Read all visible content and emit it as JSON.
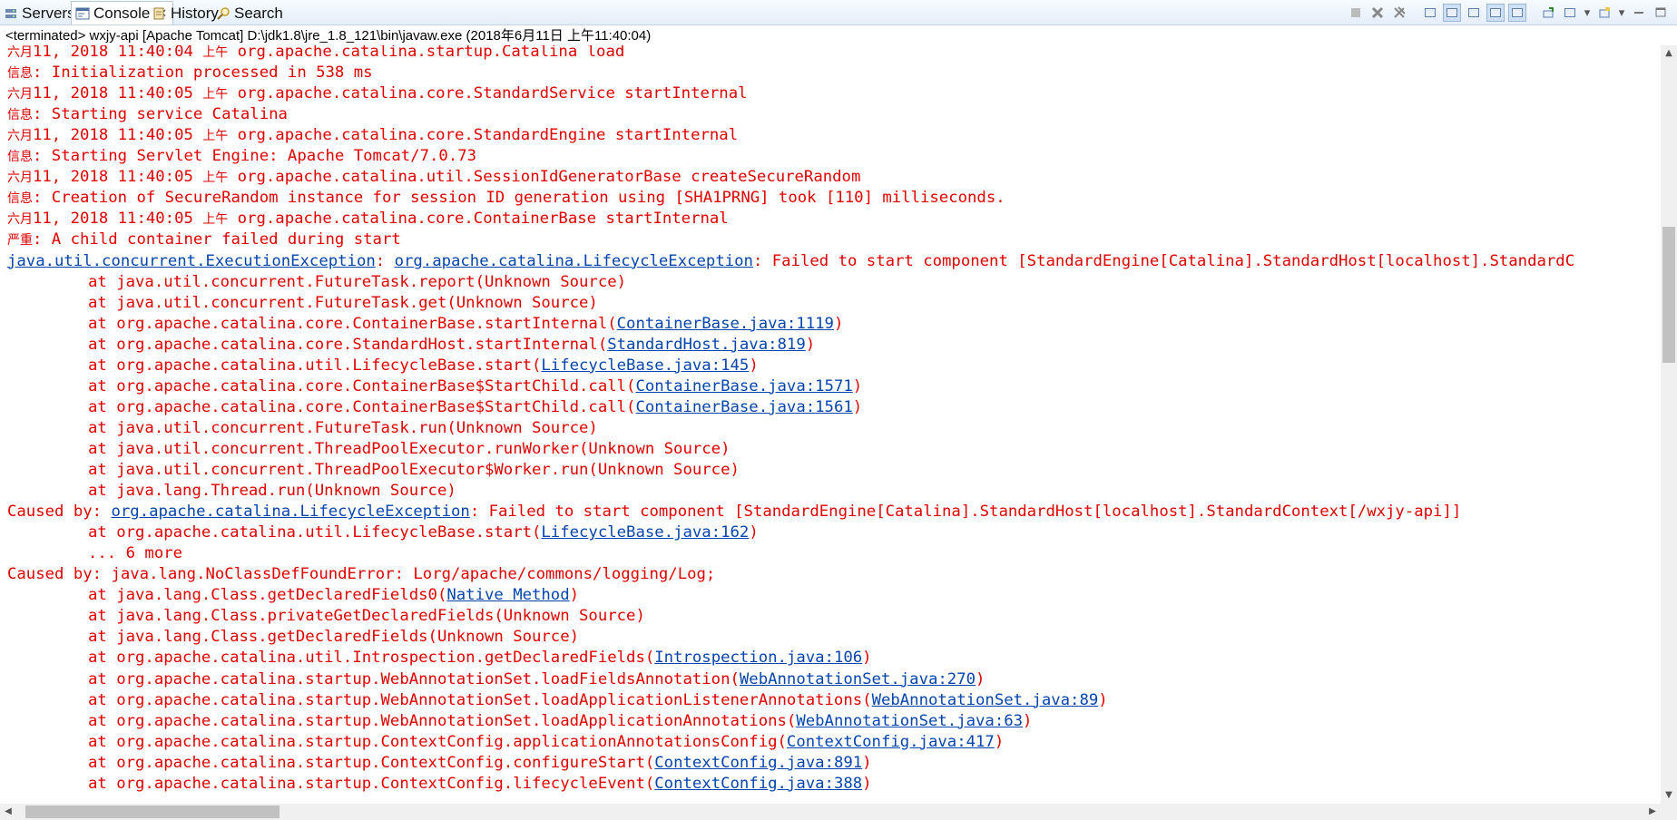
{
  "tabs": [
    {
      "label": "Servers",
      "icon": "servers-icon"
    },
    {
      "label": "Console",
      "icon": "console-icon",
      "close": "✕"
    },
    {
      "label": "History",
      "icon": "history-icon"
    },
    {
      "label": "Search",
      "icon": "search-icon"
    }
  ],
  "status": "<terminated> wxjy-api [Apache Tomcat] D:\\jdk1.8\\jre_1.8_121\\bin\\javaw.exe (2018年6月11日 上午11:40:04)",
  "colors": {
    "error": "#e00000",
    "link": "#0645ad"
  },
  "lines": [
    {
      "segs": [
        {
          "t": "六月",
          "c": 1
        },
        {
          "t": "11, 2018 11:40:04 "
        },
        {
          "t": "上午",
          "c": 1
        },
        {
          "t": " org.apache.catalina.startup.Catalina load"
        }
      ]
    },
    {
      "segs": [
        {
          "t": "信息",
          "c": 1
        },
        {
          "t": ": Initialization processed in 538 ms"
        }
      ]
    },
    {
      "segs": [
        {
          "t": "六月",
          "c": 1
        },
        {
          "t": "11, 2018 11:40:05 "
        },
        {
          "t": "上午",
          "c": 1
        },
        {
          "t": " org.apache.catalina.core.StandardService startInternal"
        }
      ]
    },
    {
      "segs": [
        {
          "t": "信息",
          "c": 1
        },
        {
          "t": ": Starting service Catalina"
        }
      ]
    },
    {
      "segs": [
        {
          "t": "六月",
          "c": 1
        },
        {
          "t": "11, 2018 11:40:05 "
        },
        {
          "t": "上午",
          "c": 1
        },
        {
          "t": " org.apache.catalina.core.StandardEngine startInternal"
        }
      ]
    },
    {
      "segs": [
        {
          "t": "信息",
          "c": 1
        },
        {
          "t": ": Starting Servlet Engine: Apache Tomcat/7.0.73"
        }
      ]
    },
    {
      "segs": [
        {
          "t": "六月",
          "c": 1
        },
        {
          "t": "11, 2018 11:40:05 "
        },
        {
          "t": "上午",
          "c": 1
        },
        {
          "t": " org.apache.catalina.util.SessionIdGeneratorBase createSecureRandom"
        }
      ]
    },
    {
      "segs": [
        {
          "t": "信息",
          "c": 1
        },
        {
          "t": ": Creation of SecureRandom instance for session ID generation using [SHA1PRNG] took [110] milliseconds."
        }
      ]
    },
    {
      "segs": [
        {
          "t": "六月",
          "c": 1
        },
        {
          "t": "11, 2018 11:40:05 "
        },
        {
          "t": "上午",
          "c": 1
        },
        {
          "t": " org.apache.catalina.core.ContainerBase startInternal"
        }
      ]
    },
    {
      "segs": [
        {
          "t": "严重",
          "c": 1
        },
        {
          "t": ": A child container failed during start"
        }
      ]
    },
    {
      "segs": [
        {
          "t": "java.util.concurrent.ExecutionException",
          "l": 1
        },
        {
          "t": ": "
        },
        {
          "t": "org.apache.catalina.LifecycleException",
          "l": 1
        },
        {
          "t": ": Failed to start component [StandardEngine[Catalina].StandardHost[localhost].StandardC"
        }
      ]
    },
    {
      "ind": 1,
      "segs": [
        {
          "t": "at java.util.concurrent.FutureTask.report(Unknown Source)"
        }
      ]
    },
    {
      "ind": 1,
      "segs": [
        {
          "t": "at java.util.concurrent.FutureTask.get(Unknown Source)"
        }
      ]
    },
    {
      "ind": 1,
      "segs": [
        {
          "t": "at org.apache.catalina.core.ContainerBase.startInternal("
        },
        {
          "t": "ContainerBase.java:1119",
          "l": 1
        },
        {
          "t": ")"
        }
      ]
    },
    {
      "ind": 1,
      "segs": [
        {
          "t": "at org.apache.catalina.core.StandardHost.startInternal("
        },
        {
          "t": "StandardHost.java:819",
          "l": 1
        },
        {
          "t": ")"
        }
      ]
    },
    {
      "ind": 1,
      "segs": [
        {
          "t": "at org.apache.catalina.util.LifecycleBase.start("
        },
        {
          "t": "LifecycleBase.java:145",
          "l": 1
        },
        {
          "t": ")"
        }
      ]
    },
    {
      "ind": 1,
      "segs": [
        {
          "t": "at org.apache.catalina.core.ContainerBase$StartChild.call("
        },
        {
          "t": "ContainerBase.java:1571",
          "l": 1
        },
        {
          "t": ")"
        }
      ]
    },
    {
      "ind": 1,
      "segs": [
        {
          "t": "at org.apache.catalina.core.ContainerBase$StartChild.call("
        },
        {
          "t": "ContainerBase.java:1561",
          "l": 1
        },
        {
          "t": ")"
        }
      ]
    },
    {
      "ind": 1,
      "segs": [
        {
          "t": "at java.util.concurrent.FutureTask.run(Unknown Source)"
        }
      ]
    },
    {
      "ind": 1,
      "segs": [
        {
          "t": "at java.util.concurrent.ThreadPoolExecutor.runWorker(Unknown Source)"
        }
      ]
    },
    {
      "ind": 1,
      "segs": [
        {
          "t": "at java.util.concurrent.ThreadPoolExecutor$Worker.run(Unknown Source)"
        }
      ]
    },
    {
      "ind": 1,
      "segs": [
        {
          "t": "at java.lang.Thread.run(Unknown Source)"
        }
      ]
    },
    {
      "segs": [
        {
          "t": "Caused by: "
        },
        {
          "t": "org.apache.catalina.LifecycleException",
          "l": 1
        },
        {
          "t": ": Failed to start component [StandardEngine[Catalina].StandardHost[localhost].StandardContext[/wxjy-api]]"
        }
      ]
    },
    {
      "ind": 1,
      "segs": [
        {
          "t": "at org.apache.catalina.util.LifecycleBase.start("
        },
        {
          "t": "LifecycleBase.java:162",
          "l": 1
        },
        {
          "t": ")"
        }
      ]
    },
    {
      "ind": 1,
      "segs": [
        {
          "t": "... 6 more"
        }
      ]
    },
    {
      "segs": [
        {
          "t": "Caused by: java.lang.NoClassDefFoundError: Lorg/apache/commons/logging/Log;"
        }
      ]
    },
    {
      "ind": 1,
      "segs": [
        {
          "t": "at java.lang.Class.getDeclaredFields0("
        },
        {
          "t": "Native Method",
          "l": 1
        },
        {
          "t": ")"
        }
      ]
    },
    {
      "ind": 1,
      "segs": [
        {
          "t": "at java.lang.Class.privateGetDeclaredFields(Unknown Source)"
        }
      ]
    },
    {
      "ind": 1,
      "segs": [
        {
          "t": "at java.lang.Class.getDeclaredFields(Unknown Source)"
        }
      ]
    },
    {
      "ind": 1,
      "segs": [
        {
          "t": "at org.apache.catalina.util.Introspection.getDeclaredFields("
        },
        {
          "t": "Introspection.java:106",
          "l": 1
        },
        {
          "t": ")"
        }
      ]
    },
    {
      "ind": 1,
      "segs": [
        {
          "t": "at org.apache.catalina.startup.WebAnnotationSet.loadFieldsAnnotation("
        },
        {
          "t": "WebAnnotationSet.java:270",
          "l": 1
        },
        {
          "t": ")"
        }
      ]
    },
    {
      "ind": 1,
      "segs": [
        {
          "t": "at org.apache.catalina.startup.WebAnnotationSet.loadApplicationListenerAnnotations("
        },
        {
          "t": "WebAnnotationSet.java:89",
          "l": 1
        },
        {
          "t": ")"
        }
      ]
    },
    {
      "ind": 1,
      "segs": [
        {
          "t": "at org.apache.catalina.startup.WebAnnotationSet.loadApplicationAnnotations("
        },
        {
          "t": "WebAnnotationSet.java:63",
          "l": 1
        },
        {
          "t": ")"
        }
      ]
    },
    {
      "ind": 1,
      "segs": [
        {
          "t": "at org.apache.catalina.startup.ContextConfig.applicationAnnotationsConfig("
        },
        {
          "t": "ContextConfig.java:417",
          "l": 1
        },
        {
          "t": ")"
        }
      ]
    },
    {
      "ind": 1,
      "segs": [
        {
          "t": "at org.apache.catalina.startup.ContextConfig.configureStart("
        },
        {
          "t": "ContextConfig.java:891",
          "l": 1
        },
        {
          "t": ")"
        }
      ]
    },
    {
      "ind": 1,
      "segs": [
        {
          "t": "at org.apache.catalina.startup.ContextConfig.lifecycleEvent("
        },
        {
          "t": "ContextConfig.java:388",
          "l": 1
        },
        {
          "t": ")"
        }
      ]
    }
  ]
}
